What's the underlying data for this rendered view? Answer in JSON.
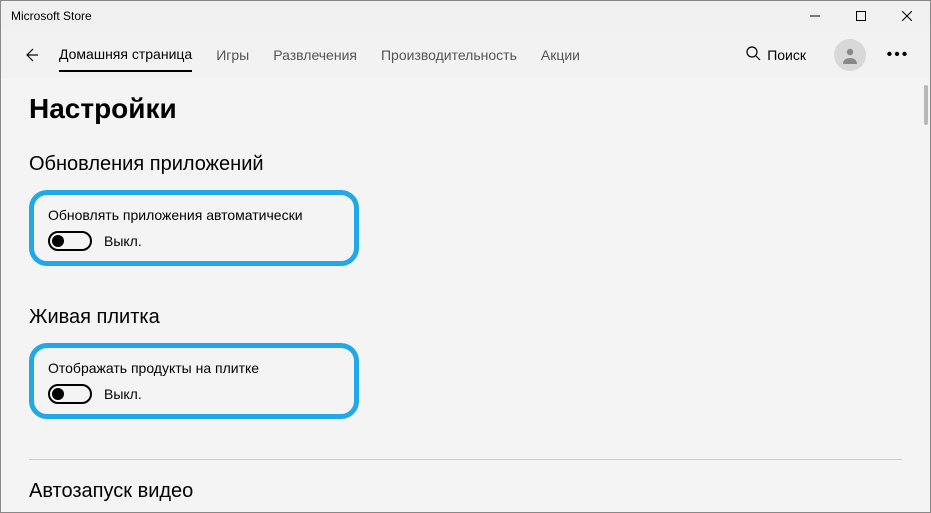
{
  "window": {
    "title": "Microsoft Store"
  },
  "nav": {
    "tabs": [
      {
        "label": "Домашняя страница",
        "active": true
      },
      {
        "label": "Игры",
        "active": false
      },
      {
        "label": "Развлечения",
        "active": false
      },
      {
        "label": "Производительность",
        "active": false
      },
      {
        "label": "Акции",
        "active": false
      }
    ],
    "search_label": "Поиск"
  },
  "page": {
    "title": "Настройки",
    "sections": [
      {
        "title": "Обновления приложений",
        "setting_label": "Обновлять приложения автоматически",
        "toggle_state": "Выкл.",
        "highlighted": true
      },
      {
        "title": "Живая плитка",
        "setting_label": "Отображать продукты на плитке",
        "toggle_state": "Выкл.",
        "highlighted": true
      },
      {
        "title": "Автозапуск видео",
        "setting_label": null,
        "toggle_state": null,
        "highlighted": false
      }
    ]
  }
}
